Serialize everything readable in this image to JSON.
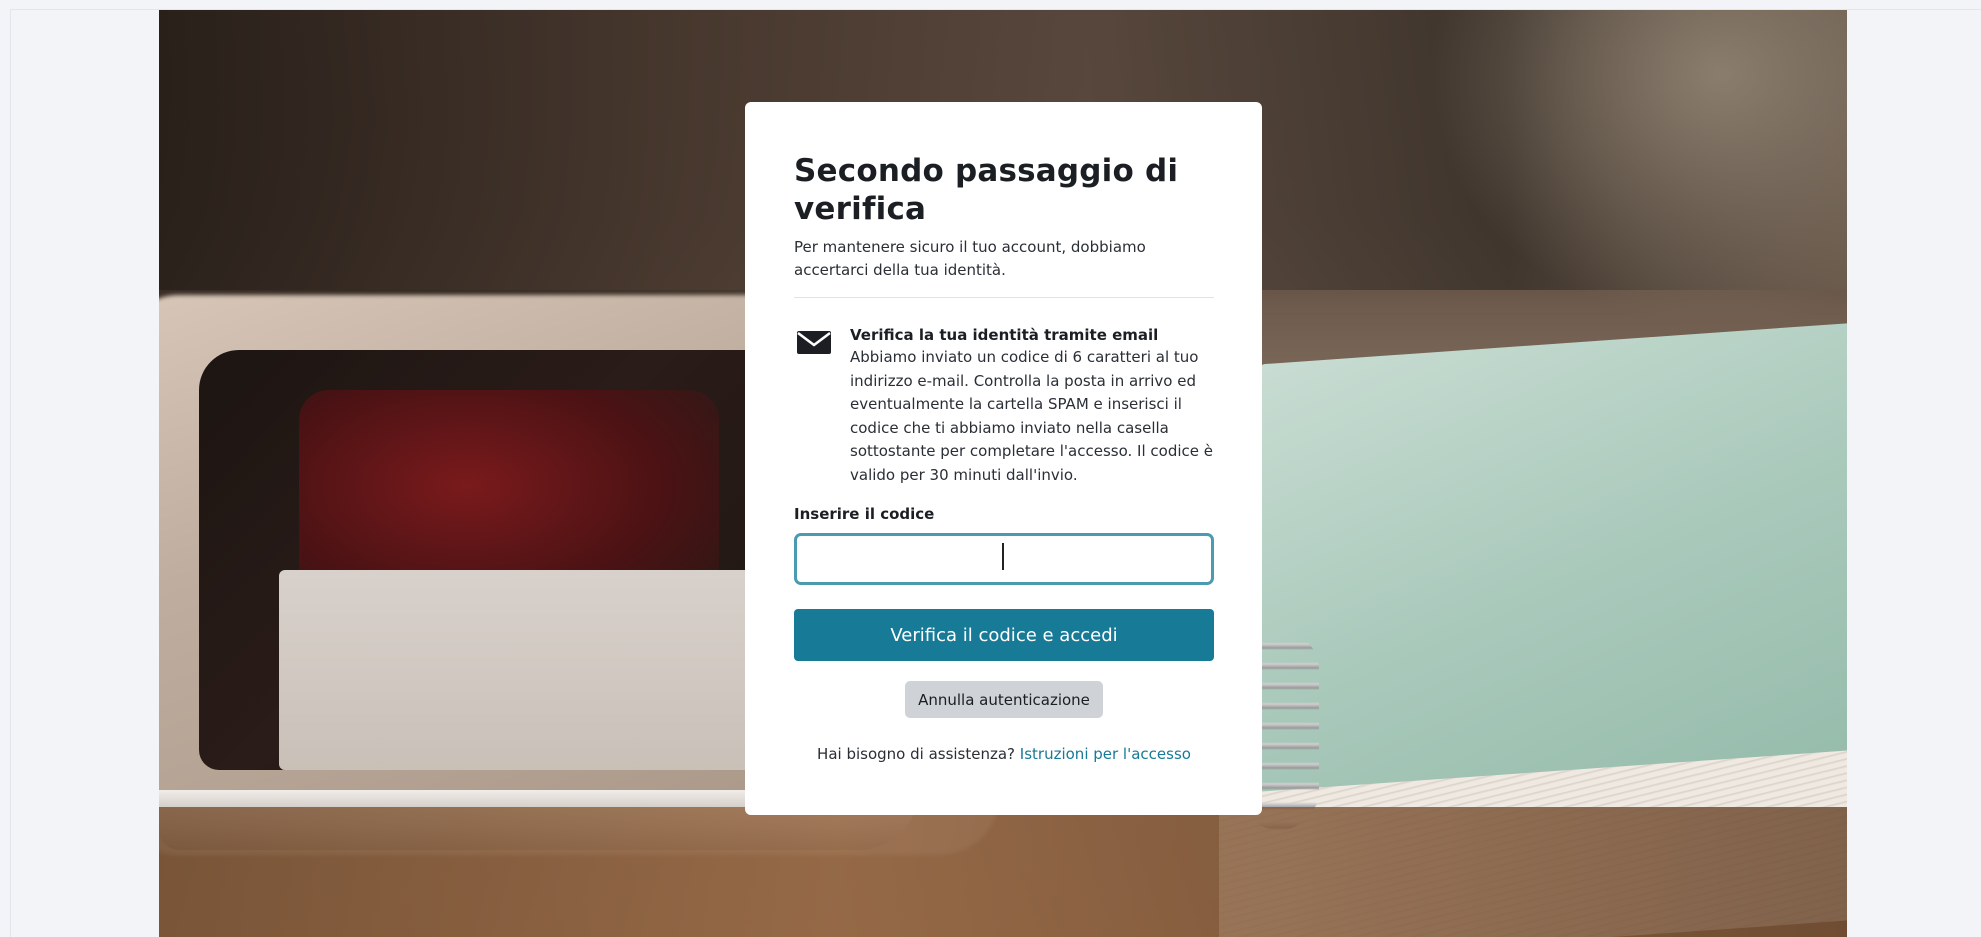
{
  "background": {
    "image": "blurred-desk-photo"
  },
  "card": {
    "title": "Secondo passaggio di verifica",
    "subtitle": "Per mantenere sicuro il tuo account, dobbiamo accertarci della tua identità.",
    "method": {
      "icon": "envelope-icon",
      "title": "Verifica la tua identità tramite email",
      "description": "Abbiamo inviato un codice di 6 caratteri al tuo indirizzo e-mail. Controlla la posta in arrivo ed eventualmente la cartella SPAM e inserisci il codice che ti abbiamo inviato nella casella sottostante per completare l'accesso. Il codice è valido per 30 minuti dall'invio."
    },
    "code_label": "Inserire il codice",
    "code_value": "",
    "code_placeholder": "",
    "verify_button": "Verifica il codice e accedi",
    "cancel_button": "Annulla autenticazione",
    "help_text": "Hai bisogno di assistenza?",
    "help_link": "Istruzioni per l'accesso"
  },
  "colors": {
    "primary": "#177a97",
    "input_border": "#4a9ab0",
    "secondary_bg": "#cfd3d8",
    "page_bg": "#f2f4f8"
  }
}
